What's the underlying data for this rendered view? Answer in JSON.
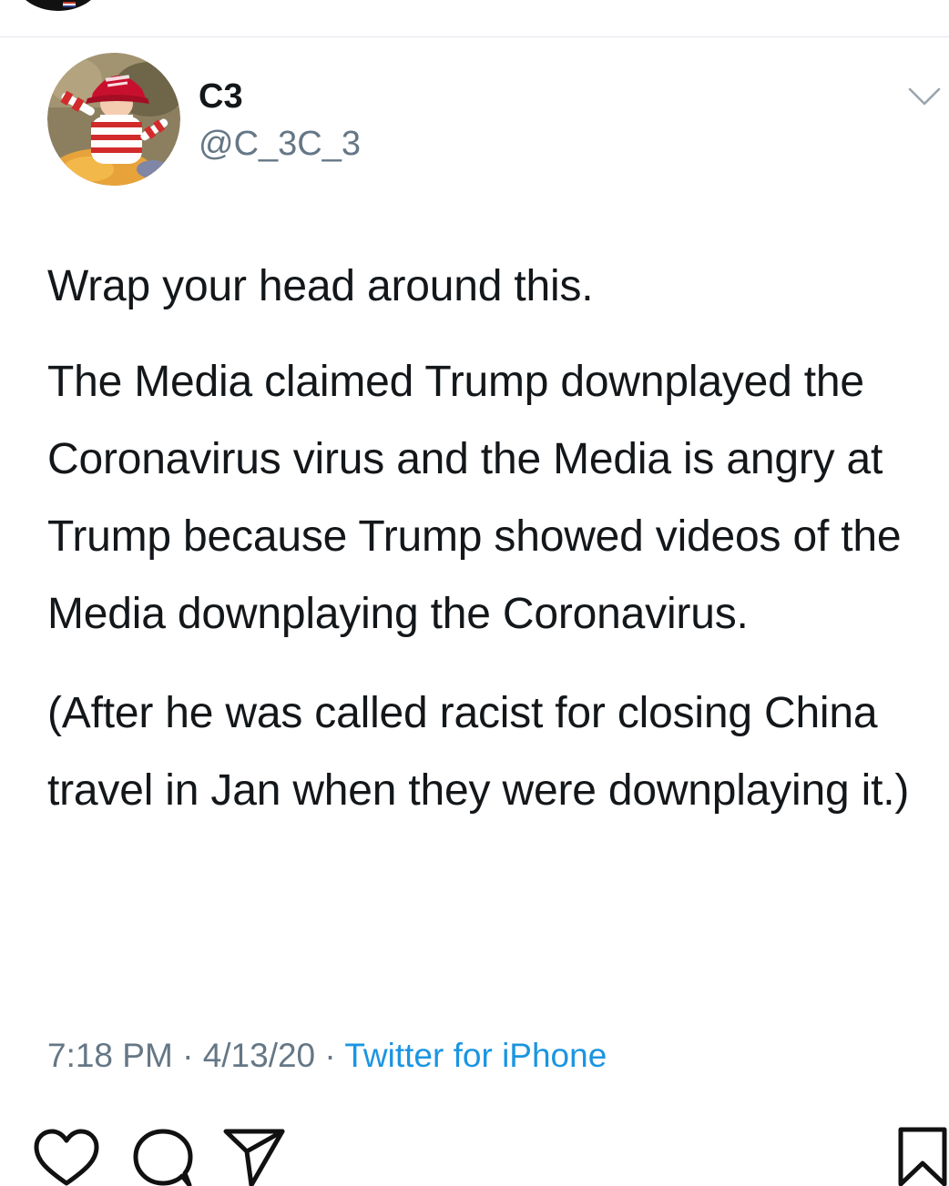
{
  "header": {
    "avatar_icon": "profile-avatar-icon",
    "flag_icon": "us-flag-icon"
  },
  "tweet": {
    "display_name": "C3",
    "handle": "@C_3C_3",
    "avatar_icon": "profile-photo-icon",
    "menu_icon": "chevron-down-icon",
    "paragraphs": [
      "Wrap your head around this.",
      "The Media claimed Trump downplayed the Coronavirus virus and the Media is angry at Trump because Trump showed videos of the Media downplaying the Coronavirus.",
      "(After he was called racist for closing China travel in Jan when they were downplaying it.)"
    ],
    "time": "7:18 PM",
    "separator": "·",
    "date": "4/13/20",
    "source": "Twitter for iPhone"
  },
  "actions": {
    "like_icon": "heart-icon",
    "comment_icon": "comment-icon",
    "share_icon": "send-icon",
    "save_icon": "bookmark-icon"
  },
  "colors": {
    "text": "#14171a",
    "muted": "#657786",
    "link": "#1b95e0",
    "divider": "#e1e8ed"
  }
}
